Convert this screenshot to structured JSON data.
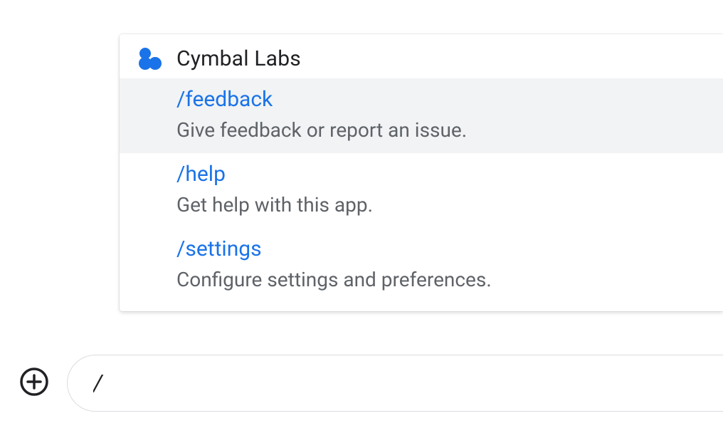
{
  "popup": {
    "title": "Cymbal Labs",
    "commands": [
      {
        "name": "/feedback",
        "description": "Give feedback or report an issue.",
        "highlighted": true
      },
      {
        "name": "/help",
        "description": "Get help with this app.",
        "highlighted": false
      },
      {
        "name": "/settings",
        "description": "Configure settings and preferences.",
        "highlighted": false
      }
    ]
  },
  "input": {
    "value": "/"
  },
  "colors": {
    "link": "#1a73e8",
    "textPrimary": "#202124",
    "textSecondary": "#5f6368",
    "highlight": "#f1f3f4",
    "brandBlue": "#1a73e8"
  }
}
